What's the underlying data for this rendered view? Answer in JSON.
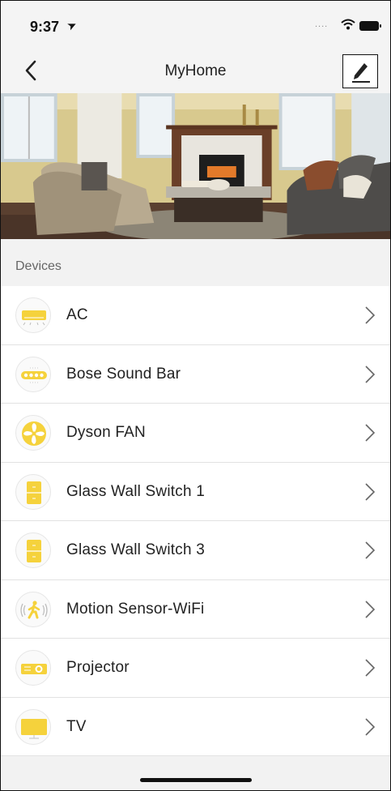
{
  "status_bar": {
    "time": "9:37",
    "signal": "....",
    "icons": [
      "location-arrow-icon",
      "wifi-icon",
      "battery-icon"
    ]
  },
  "nav": {
    "title": "MyHome",
    "back_icon": "chevron-left-icon",
    "edit_icon": "pencil-icon"
  },
  "hero": {
    "image": "living-room-photo"
  },
  "devices_section": {
    "label": "Devices",
    "items": [
      {
        "label": "AC",
        "icon": "air-conditioner-icon"
      },
      {
        "label": "Bose Sound Bar",
        "icon": "sound-bar-icon"
      },
      {
        "label": "Dyson FAN",
        "icon": "fan-icon"
      },
      {
        "label": "Glass Wall Switch 1",
        "icon": "wall-switch-icon"
      },
      {
        "label": "Glass Wall Switch 3",
        "icon": "wall-switch-icon"
      },
      {
        "label": "Motion Sensor-WiFi",
        "icon": "motion-sensor-icon"
      },
      {
        "label": "Projector",
        "icon": "projector-icon"
      },
      {
        "label": "TV",
        "icon": "tv-icon"
      }
    ]
  },
  "colors": {
    "accent_yellow": "#f5d23c",
    "icon_border": "#e6e6e6",
    "background": "#f2f2f2",
    "row_background": "#ffffff",
    "text": "#222222",
    "secondary_text": "#666666"
  }
}
